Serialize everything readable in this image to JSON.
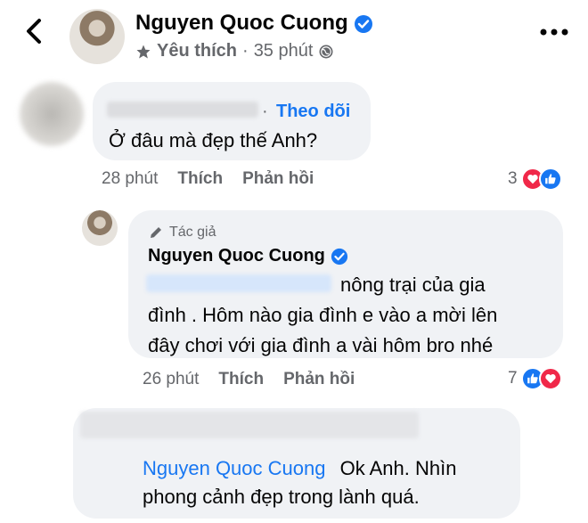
{
  "header": {
    "name": "Nguyen Quoc Cuong",
    "favorite_label": "Yêu thích",
    "separator": "·",
    "time": "35 phút"
  },
  "comment1": {
    "follow_label": "Theo dõi",
    "follow_dot": "·",
    "text": "Ở đâu mà đẹp thế Anh?",
    "time": "28 phút",
    "like_label": "Thích",
    "reply_label": "Phản hồi",
    "reaction_count": "3"
  },
  "reply1": {
    "author_badge": "Tác giả",
    "name": "Nguyen Quoc Cuong",
    "line1": "nông trại của gia",
    "line2": "đình . Hôm nào gia đình e vào a mời lên",
    "line3": "đây chơi với gia đình a vài hôm bro nhé",
    "time": "26 phút",
    "like_label": "Thích",
    "reply_label": "Phản hồi",
    "reaction_count": "7"
  },
  "reply2": {
    "mention": "Nguyen Quoc Cuong",
    "text": "Ok Anh. Nhìn",
    "line2": "phong cảnh đẹp trong lành quá."
  },
  "colors": {
    "accent": "#1877f2",
    "bubble": "#f0f2f5",
    "heart": "#f02849",
    "meta": "#65676b"
  },
  "icons": [
    "back-chevron-icon",
    "verified-icon",
    "star-icon",
    "globe-icon",
    "more-icon",
    "pencil-icon",
    "heart-reaction-icon",
    "like-reaction-icon"
  ]
}
